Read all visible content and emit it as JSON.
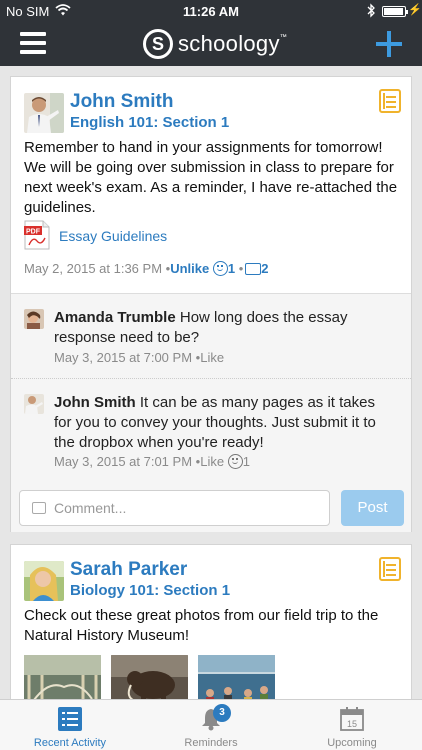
{
  "status_bar": {
    "carrier": "No SIM",
    "time": "11:26 AM"
  },
  "nav": {
    "logo_letter": "S",
    "logo_text": "schoology",
    "logo_mark": "™"
  },
  "posts": [
    {
      "author": "John Smith",
      "section": "English 101: Section 1",
      "body": "Remember to hand in your assignments for tomorrow! We will be going over submission in class to prepare for next week's exam. As a reminder, I have re-attached the guidelines.",
      "attachment": "Essay Guidelines",
      "date": "May 2, 2015 at 1:36 PM",
      "separator": "•",
      "like_label": "Unlike",
      "like_count": "1",
      "comment_count": "2",
      "comments": [
        {
          "author": "Amanda Trumble",
          "text": "How long does the essay response need to be?",
          "date": "May 3, 2015 at 7:00 PM",
          "separator": "•",
          "like_label": "Like",
          "like_count": ""
        },
        {
          "author": "John Smith",
          "text": "It can be as many pages as it takes for you to convey your thoughts. Just submit it to the dropbox when you're ready!",
          "date": "May 3, 2015 at 7:01 PM",
          "separator": "•",
          "like_label": "Like",
          "like_count": "1"
        }
      ],
      "comment_placeholder": "Comment...",
      "post_button": "Post"
    },
    {
      "author": "Sarah Parker",
      "section": "Biology 101: Section 1",
      "body": "Check out these great photos from our field trip to the Natural History Museum!",
      "photos": [
        "museum-hall-photo",
        "mammoth-exhibit-photo",
        "museum-crowd-photo"
      ]
    }
  ],
  "tabs": [
    {
      "label": "Recent Activity",
      "icon": "list-icon",
      "active": true
    },
    {
      "label": "Reminders",
      "icon": "bell-icon",
      "badge": "3"
    },
    {
      "label": "Upcoming",
      "icon": "calendar-icon",
      "calendar_day": "15"
    }
  ],
  "colors": {
    "bar_bg": "#2f3338",
    "accent": "#2c7bbf",
    "post_icon": "#f0b32c",
    "post_button": "#9bcbee"
  }
}
